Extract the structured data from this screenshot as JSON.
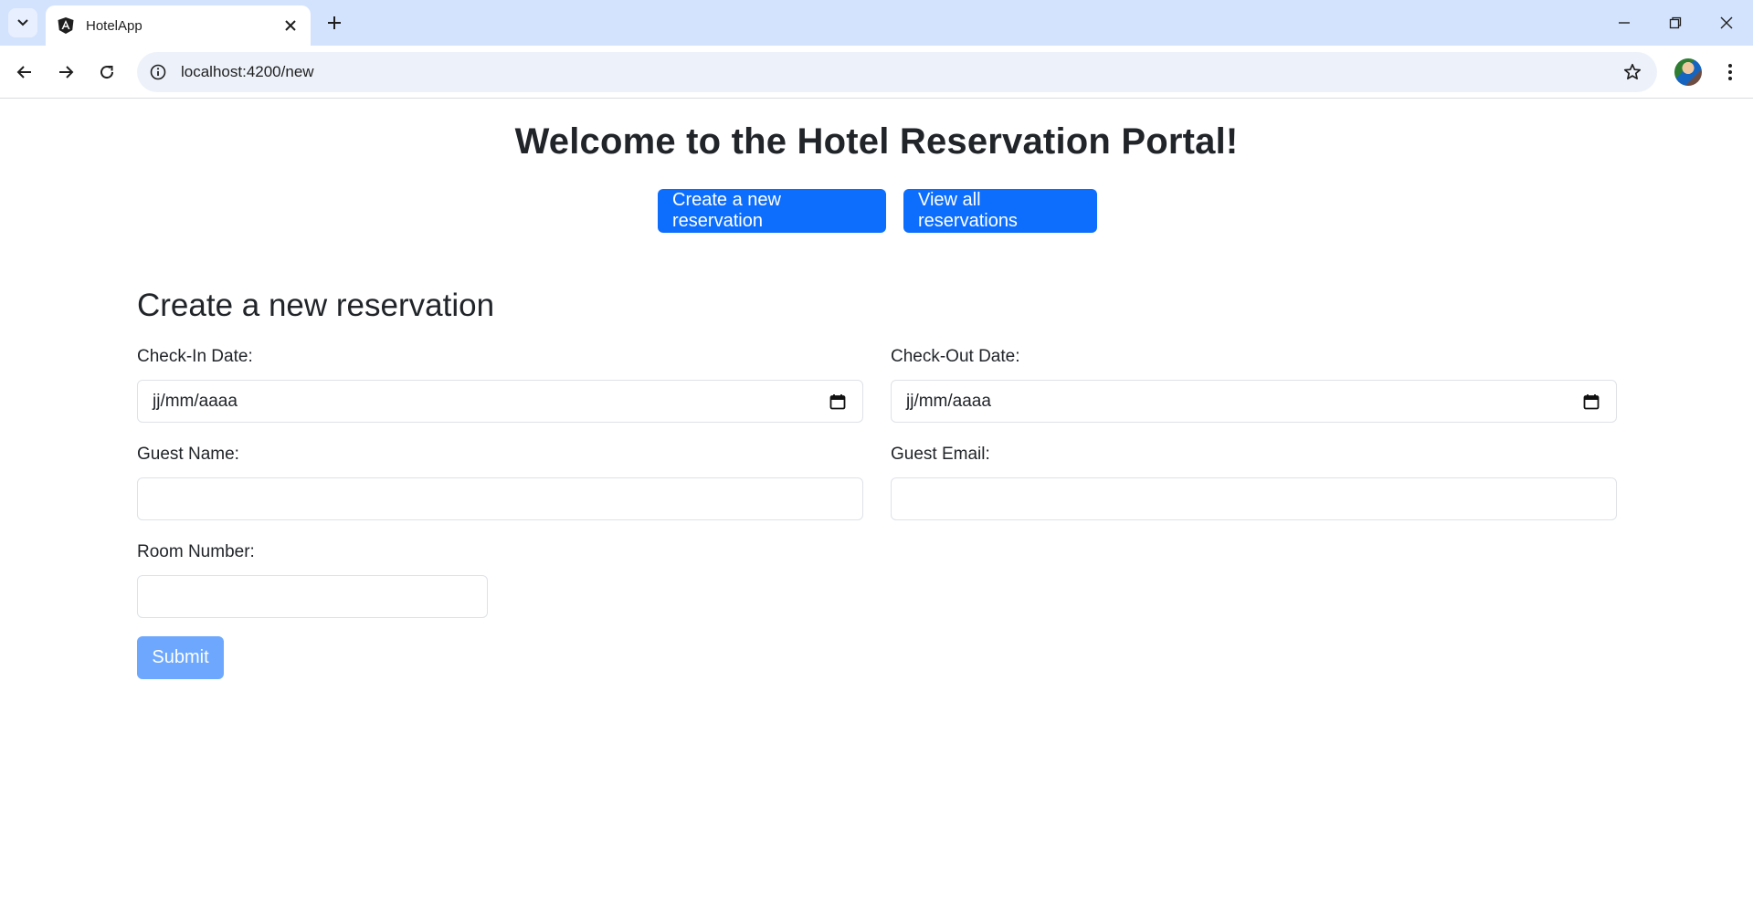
{
  "browser": {
    "tab_title": "HotelApp",
    "url": "localhost:4200/new"
  },
  "page": {
    "heading": "Welcome to the Hotel Reservation Portal!",
    "nav": {
      "create_label": "Create a new reservation",
      "view_label": "View all reservations"
    },
    "form": {
      "title": "Create a new reservation",
      "check_in_label": "Check-In Date:",
      "check_in_value": "jj/mm/aaaa",
      "check_out_label": "Check-Out Date:",
      "check_out_value": "jj/mm/aaaa",
      "guest_name_label": "Guest Name:",
      "guest_email_label": "Guest Email:",
      "room_number_label": "Room Number:",
      "submit_label": "Submit"
    }
  },
  "colors": {
    "primary": "#0d6efd",
    "primary_disabled": "#6ea8fe",
    "tabstrip": "#d3e3fd",
    "omnibox": "#edf2fa"
  },
  "icons": [
    "tab-search-icon",
    "angular-logo-icon",
    "close-icon",
    "plus-icon",
    "minimize-icon",
    "restore-icon",
    "back-icon",
    "forward-icon",
    "reload-icon",
    "info-icon",
    "star-icon",
    "more-vert-icon",
    "calendar-icon"
  ]
}
